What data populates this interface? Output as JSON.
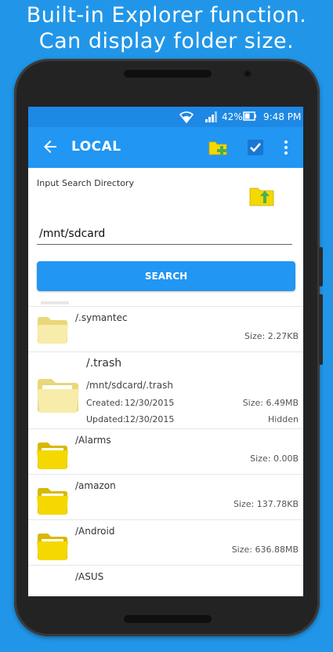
{
  "headline": {
    "line1": "Built-in Explorer function.",
    "line2": "Can display folder size."
  },
  "status_bar": {
    "battery": "42%",
    "time": "9:48 PM"
  },
  "app_bar": {
    "title": "LOCAL"
  },
  "search": {
    "label": "Input Search Directory",
    "value": "/mnt/sdcard",
    "button_label": "SEARCH"
  },
  "folders": [
    {
      "name": "/.symantec",
      "size": "Size: 2.27KB"
    },
    {
      "name": "/.trash",
      "path": "/mnt/sdcard/.trash",
      "created_label": "Created:",
      "created": "12/30/2015",
      "updated_label": "Updated:",
      "updated": "12/30/2015",
      "size": "Size: 6.49MB",
      "attribute": "Hidden"
    },
    {
      "name": "/Alarms",
      "size": "Size: 0.00B"
    },
    {
      "name": "/amazon",
      "size": "Size: 137.78KB"
    },
    {
      "name": "/Android",
      "size": "Size: 636.88MB"
    },
    {
      "name": "/ASUS"
    }
  ],
  "colors": {
    "background": "#2196e8",
    "app_bar": "#2196f3",
    "status_bar": "#1e88e5",
    "folder_yellow": "#f5d800",
    "folder_pale": "#f7ecaa"
  },
  "icons": {
    "back": "arrow-left-icon",
    "new_folder": "new-folder-icon",
    "select": "checkbox-icon",
    "menu": "more-vert-icon",
    "up_folder": "folder-up-icon",
    "folder": "folder-icon"
  }
}
